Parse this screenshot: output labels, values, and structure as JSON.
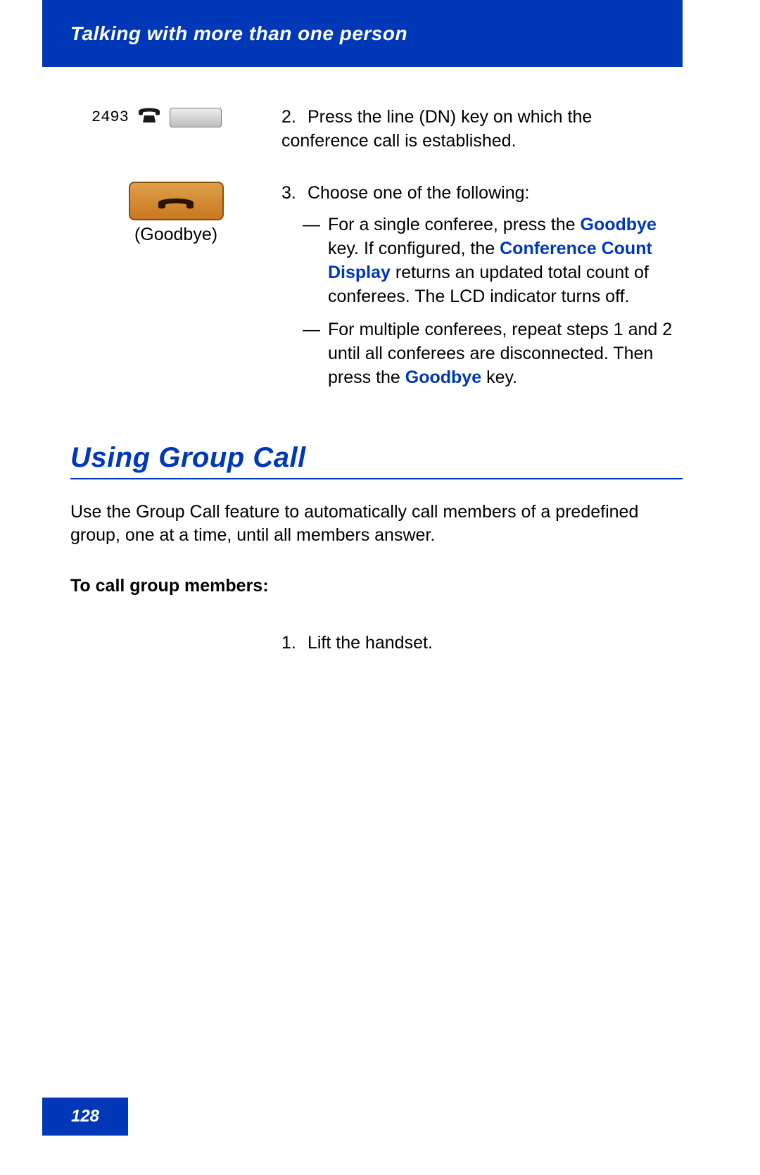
{
  "header": {
    "title": "Talking with more than one person"
  },
  "step2": {
    "dn": "2493",
    "num": "2.",
    "text": "Press the line (DN) key on which the conference call is established."
  },
  "step3": {
    "goodbye_label": "(Goodbye)",
    "num": "3.",
    "intro": "Choose one of the following:",
    "bullet1_pre": "For a single conferee, press the ",
    "bullet1_goodbye": "Goodbye",
    "bullet1_mid": " key. If configured, the ",
    "bullet1_ccd": "Conference Count Display",
    "bullet1_post": " returns an updated total count of conferees. The LCD indicator turns off.",
    "bullet2_pre": "For multiple conferees, repeat steps 1 and 2 until all conferees are disconnected. Then press the ",
    "bullet2_goodbye": "Goodbye",
    "bullet2_post": " key."
  },
  "section": {
    "heading": "Using Group Call",
    "intro": "Use the Group Call feature to automatically call members of a predefined group, one at a time, until all members answer.",
    "subheading": "To call group members:",
    "step1_num": "1.",
    "step1_text": "Lift the handset."
  },
  "footer": {
    "page": "128"
  },
  "dash": "—"
}
